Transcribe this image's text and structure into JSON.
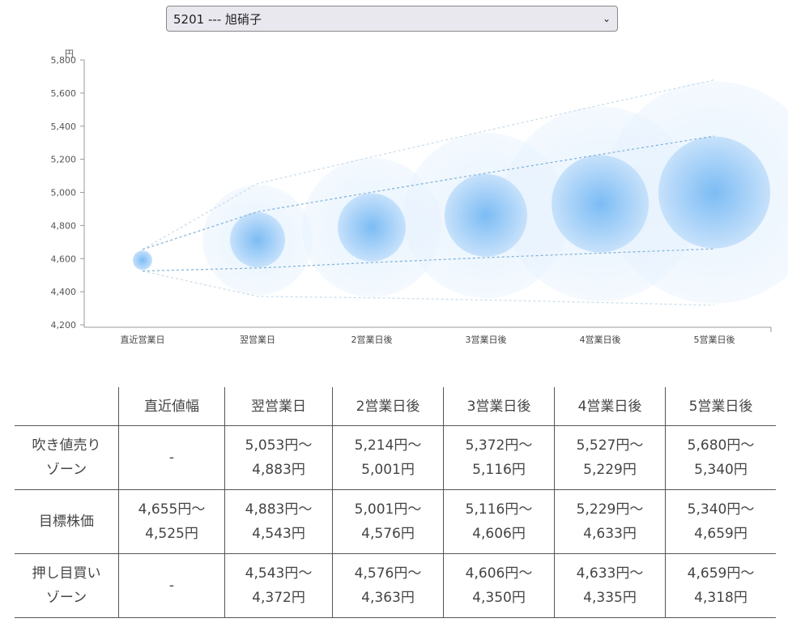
{
  "selector": {
    "value": "5201 --- 旭硝子",
    "chevron": "chevron-down-icon"
  },
  "chart_data": {
    "type": "bubble-range",
    "ylabel": "円",
    "ylim": [
      4200,
      5800
    ],
    "yticks": [
      "4,200",
      "4,400",
      "4,600",
      "4,800",
      "5,000",
      "5,200",
      "5,400",
      "5,600",
      "5,800"
    ],
    "yvals": [
      4200,
      4400,
      4600,
      4800,
      5000,
      5200,
      5400,
      5600,
      5800
    ],
    "categories": [
      "直近営業日",
      "翌営業日",
      "2営業日後",
      "3営業日後",
      "4営業日後",
      "5営業日後"
    ],
    "upper_zone": [
      4655,
      5053,
      5214,
      5372,
      5527,
      5680
    ],
    "target_high": [
      4655,
      4883,
      5001,
      5116,
      5229,
      5340
    ],
    "target_low": [
      4525,
      4543,
      4576,
      4606,
      4633,
      4659
    ],
    "lower_zone": [
      4525,
      4372,
      4363,
      4350,
      4335,
      4318
    ],
    "color": "#5aa9f0"
  },
  "table": {
    "headers": [
      "",
      "直近値幅",
      "翌営業日",
      "2営業日後",
      "3営業日後",
      "4営業日後",
      "5営業日後"
    ],
    "rows": [
      {
        "label": [
          "吹き値売り",
          "ゾーン"
        ],
        "cells": [
          [
            "-"
          ],
          [
            "5,053円～",
            "4,883円"
          ],
          [
            "5,214円～",
            "5,001円"
          ],
          [
            "5,372円～",
            "5,116円"
          ],
          [
            "5,527円～",
            "5,229円"
          ],
          [
            "5,680円～",
            "5,340円"
          ]
        ]
      },
      {
        "label": [
          "目標株価"
        ],
        "cells": [
          [
            "4,655円～",
            "4,525円"
          ],
          [
            "4,883円～",
            "4,543円"
          ],
          [
            "5,001円～",
            "4,576円"
          ],
          [
            "5,116円～",
            "4,606円"
          ],
          [
            "5,229円～",
            "4,633円"
          ],
          [
            "5,340円～",
            "4,659円"
          ]
        ]
      },
      {
        "label": [
          "押し目買い",
          "ゾーン"
        ],
        "cells": [
          [
            "-"
          ],
          [
            "4,543円～",
            "4,372円"
          ],
          [
            "4,576円～",
            "4,363円"
          ],
          [
            "4,606円～",
            "4,350円"
          ],
          [
            "4,633円～",
            "4,335円"
          ],
          [
            "4,659円～",
            "4,318円"
          ]
        ]
      }
    ]
  }
}
